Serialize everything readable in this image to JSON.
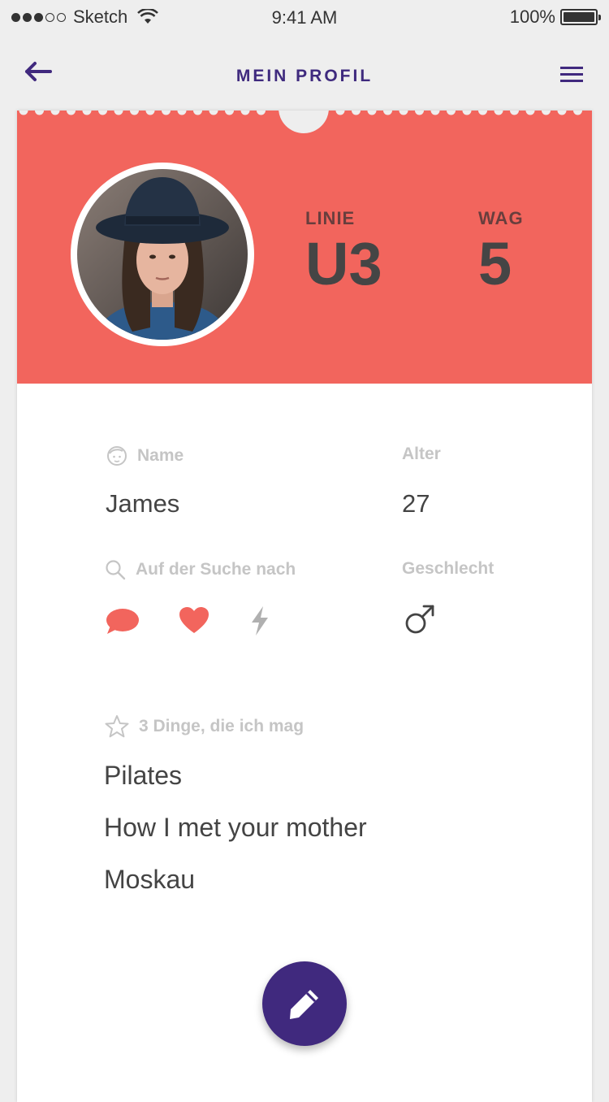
{
  "status_bar": {
    "carrier": "Sketch",
    "time": "9:41 AM",
    "battery": "100%"
  },
  "nav": {
    "title": "MEIN PROFIL",
    "back_icon": "arrow-left-icon",
    "menu_icon": "hamburger-menu-icon"
  },
  "profile": {
    "line_label": "LINIE",
    "line_value": "U3",
    "wagon_label": "WAG",
    "wagon_value": "5",
    "accent_color": "#f2655d",
    "primary_color": "#40297e"
  },
  "fields": {
    "name_label": "Name",
    "name_value": "James",
    "age_label": "Alter",
    "age_value": "27",
    "looking_for_label": "Auf der Suche nach",
    "looking_for_icons": [
      "chat-bubble-icon",
      "heart-icon",
      "lightning-icon"
    ],
    "gender_label": "Geschlecht",
    "gender_icon": "male-symbol-icon"
  },
  "likes": {
    "label": "3 Dinge, die ich mag",
    "items": [
      "Pilates",
      "How I met your mother",
      "Moskau"
    ]
  },
  "actions": {
    "edit_icon": "pencil-icon"
  }
}
